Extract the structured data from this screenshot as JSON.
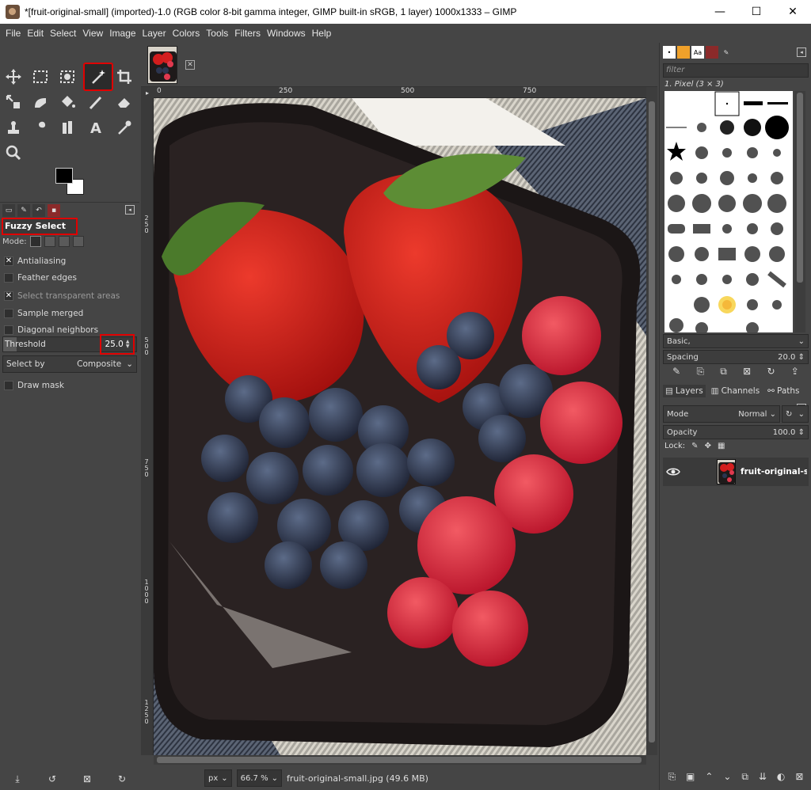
{
  "window": {
    "title": "*[fruit-original-small] (imported)-1.0 (RGB color 8-bit gamma integer, GIMP built-in sRGB, 1 layer) 1000x1333 – GIMP",
    "minimize": "—",
    "maximize": "☐",
    "close": "✕"
  },
  "menu": [
    "File",
    "Edit",
    "Select",
    "View",
    "Image",
    "Layer",
    "Colors",
    "Tools",
    "Filters",
    "Windows",
    "Help"
  ],
  "toolbox": {
    "active_tool": "fuzzy-select",
    "tools": [
      "move",
      "rect-select",
      "foreground-select",
      "fuzzy-select",
      "crop",
      "unified-transform",
      "warp",
      "bucket-fill",
      "paintbrush",
      "eraser",
      "clone",
      "smudge",
      "dodge",
      "text",
      "color-picker",
      "zoom"
    ]
  },
  "tool_options": {
    "title": "Fuzzy Select",
    "mode_label": "Mode:",
    "antialiasing": {
      "label": "Antialiasing",
      "checked": true
    },
    "feather_edges": {
      "label": "Feather edges",
      "checked": false
    },
    "select_transparent": {
      "label": "Select transparent areas",
      "checked": true
    },
    "sample_merged": {
      "label": "Sample merged",
      "checked": false
    },
    "diagonal_neighbors": {
      "label": "Diagonal neighbors",
      "checked": false
    },
    "threshold": {
      "label": "Threshold",
      "value": "25.0",
      "fraction": 0.1
    },
    "select_by": {
      "label": "Select by",
      "value": "Composite"
    },
    "draw_mask": {
      "label": "Draw mask",
      "checked": false
    }
  },
  "canvas": {
    "ruler_h": [
      "0",
      "250",
      "500",
      "750"
    ],
    "ruler_v": [
      "2\n5\n0",
      "5\n0\n0",
      "7\n5\n0",
      "1\n0\n0\n0",
      "1\n2\n5\n0"
    ],
    "image_filename": "fruit-original-small.jpg (49.6 MB)",
    "unit": "px",
    "zoom": "66.7 %"
  },
  "brushes": {
    "filter_placeholder": "filter",
    "current_brush": "1. Pixel (3 × 3)",
    "category": "Basic,",
    "spacing_label": "Spacing",
    "spacing_value": "20.0"
  },
  "layers": {
    "tabs": [
      "Layers",
      "Channels",
      "Paths"
    ],
    "mode_label": "Mode",
    "mode_value": "Normal",
    "opacity_label": "Opacity",
    "opacity_value": "100.0",
    "lock_label": "Lock:",
    "items": [
      {
        "name": "fruit-original-small",
        "visible": true
      }
    ]
  },
  "colors": {
    "active_outline": "#e00000",
    "panel_bg": "#454545"
  }
}
